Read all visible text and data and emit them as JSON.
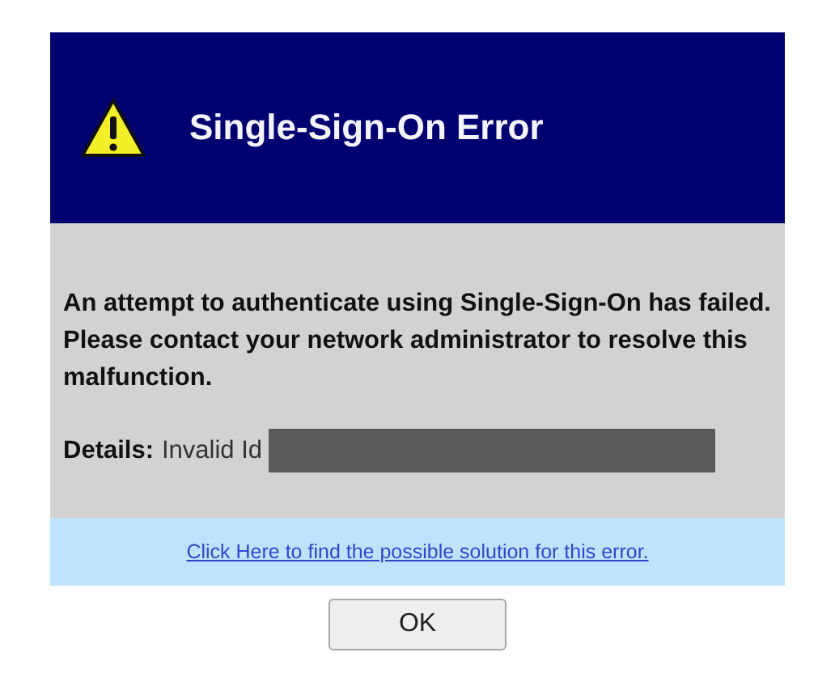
{
  "header": {
    "title": "Single-Sign-On Error"
  },
  "message": "An attempt to authenticate using Single-Sign-On has failed. Please contact your network administrator to resolve this malfunction.",
  "details": {
    "label": "Details:",
    "value": "Invalid Id"
  },
  "help_link": "Click Here to find the possible solution for this error.",
  "buttons": [
    "OK"
  ]
}
